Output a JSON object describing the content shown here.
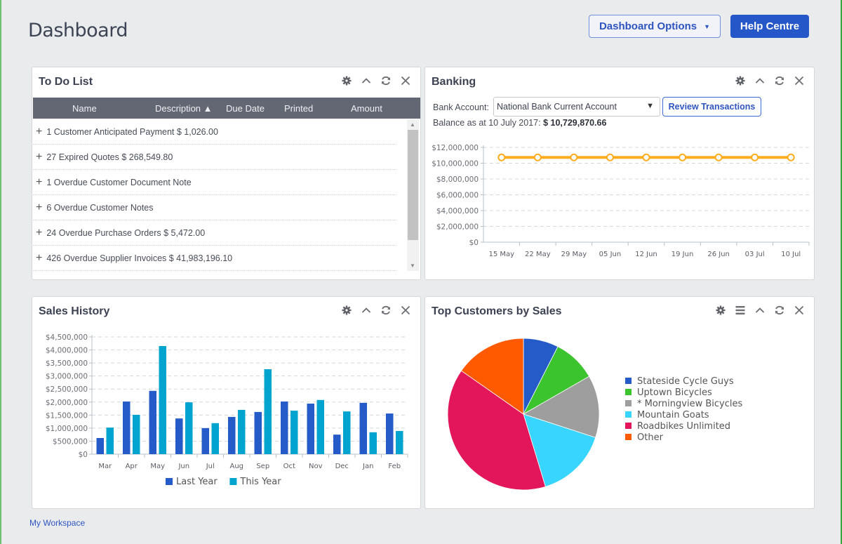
{
  "header": {
    "title": "Dashboard",
    "options_button": "Dashboard Options",
    "help_button": "Help Centre"
  },
  "todo": {
    "title": "To Do List",
    "columns": [
      "Name",
      "Description ▲",
      "Due Date",
      "Printed",
      "Amount"
    ],
    "rows": [
      "1 Customer Anticipated Payment $ 1,026.00",
      "27 Expired Quotes $ 268,549.80",
      "1 Overdue Customer Document Note",
      "6 Overdue Customer Notes",
      "24 Overdue Purchase Orders $ 5,472.00",
      "426 Overdue Supplier Invoices $ 41,983,196.10"
    ],
    "row_prefix": "+"
  },
  "banking": {
    "title": "Banking",
    "account_label": "Bank Account:",
    "account_value": "National Bank Current Account",
    "review_button": "Review Transactions",
    "balance_label": "Balance as at 10 July 2017:",
    "balance_value": "$ 10,729,870.66"
  },
  "sales": {
    "title": "Sales History"
  },
  "topcust": {
    "title": "Top Customers by Sales"
  },
  "footer": {
    "workspace_link": "My Workspace"
  },
  "icons": {
    "panel_tools": [
      "gear-icon",
      "chevron-up-icon",
      "refresh-icon",
      "close-icon"
    ],
    "topcust_tools": [
      "gear-icon",
      "menu-icon",
      "chevron-up-icon",
      "refresh-icon",
      "close-icon"
    ]
  },
  "colors": {
    "accent": "#2557c8",
    "bank_line": "#ffad1f",
    "last_year": "#255bc8",
    "this_year": "#00a4cf"
  },
  "chart_data": [
    {
      "id": "banking",
      "type": "line",
      "title": "",
      "x": [
        "15 May",
        "22 May",
        "29 May",
        "05 Jun",
        "12 Jun",
        "19 Jun",
        "26 Jun",
        "03 Jul",
        "10 Jul"
      ],
      "series": [
        {
          "name": "Balance",
          "values": [
            10729870,
            10729870,
            10729870,
            10729870,
            10729870,
            10729870,
            10729870,
            10729870,
            10729870
          ]
        }
      ],
      "yticks": [
        "$0",
        "$2,000,000",
        "$4,000,000",
        "$6,000,000",
        "$8,000,000",
        "$10,000,000",
        "$12,000,000"
      ],
      "ylim": [
        0,
        12000000
      ],
      "grid": true,
      "legend": "none"
    },
    {
      "id": "sales",
      "type": "bar",
      "categories": [
        "Mar",
        "Apr",
        "May",
        "Jun",
        "Jul",
        "Aug",
        "Sep",
        "Oct",
        "Nov",
        "Dec",
        "Jan",
        "Feb"
      ],
      "series": [
        {
          "name": "Last Year",
          "color": "#255bc8",
          "values": [
            620000,
            2020000,
            2430000,
            1370000,
            1000000,
            1430000,
            1620000,
            2020000,
            1940000,
            750000,
            1970000,
            1560000
          ]
        },
        {
          "name": "This Year",
          "color": "#00a4cf",
          "values": [
            1020000,
            1510000,
            4150000,
            1990000,
            1190000,
            1700000,
            3260000,
            1670000,
            2080000,
            1640000,
            840000,
            890000
          ]
        }
      ],
      "yticks": [
        "$0",
        "$500,000",
        "$1,000,000",
        "$1,500,000",
        "$2,000,000",
        "$2,500,000",
        "$3,000,000",
        "$3,500,000",
        "$4,000,000",
        "$4,500,000"
      ],
      "ylim": [
        0,
        4500000
      ],
      "grid": true,
      "legend": "bottom"
    },
    {
      "id": "topcust",
      "type": "pie",
      "slices": [
        {
          "label": "Stateside Cycle Guys",
          "value": 7.5,
          "color": "#255bc8"
        },
        {
          "label": "Uptown Bicycles",
          "value": 9.2,
          "color": "#3cc42e"
        },
        {
          "label": "* Morningview Bicycles",
          "value": 13.3,
          "color": "#9e9e9e"
        },
        {
          "label": "Mountain Goats",
          "value": 15.3,
          "color": "#38d6ff"
        },
        {
          "label": "Roadbikes Unlimited",
          "value": 39.4,
          "color": "#e3165b"
        },
        {
          "label": "Other",
          "value": 15.3,
          "color": "#ff5a00"
        }
      ],
      "legend": "right"
    }
  ]
}
